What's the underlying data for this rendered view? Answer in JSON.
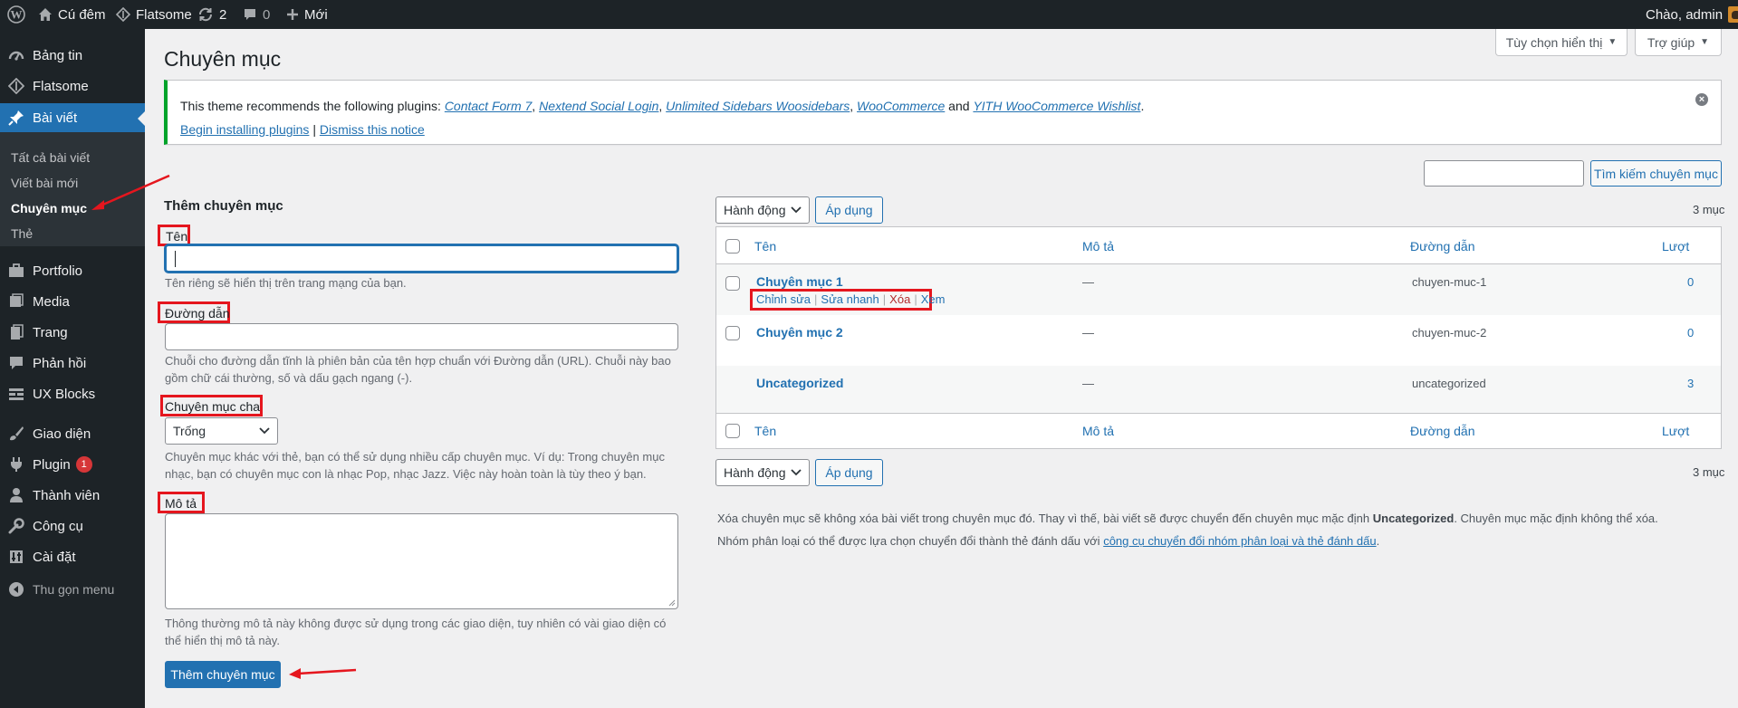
{
  "adminbar": {
    "site_name": "Cú đêm",
    "theme_name": "Flatsome",
    "updates_count": "2",
    "comments_count": "0",
    "new_label": "Mới",
    "greeting": "Chào, admin"
  },
  "sidebar": {
    "items": [
      {
        "label": "Bảng tin",
        "icon": "dashboard-icon"
      },
      {
        "label": "Flatsome",
        "icon": "flatsome-icon"
      },
      {
        "label": "Bài viết",
        "icon": "pin-icon"
      },
      {
        "label": "Portfolio",
        "icon": "portfolio-icon"
      },
      {
        "label": "Media",
        "icon": "media-icon"
      },
      {
        "label": "Trang",
        "icon": "page-icon"
      },
      {
        "label": "Phản hồi",
        "icon": "comment-icon"
      },
      {
        "label": "UX Blocks",
        "icon": "blocks-icon"
      },
      {
        "label": "Giao diện",
        "icon": "brush-icon"
      },
      {
        "label": "Plugin",
        "icon": "plugin-icon",
        "badge": "1"
      },
      {
        "label": "Thành viên",
        "icon": "user-icon"
      },
      {
        "label": "Công cụ",
        "icon": "wrench-icon"
      },
      {
        "label": "Cài đặt",
        "icon": "settings-icon"
      }
    ],
    "submenu": [
      "Tất cả bài viết",
      "Viết bài mới",
      "Chuyên mục",
      "Thẻ"
    ],
    "collapse_label": "Thu gọn menu"
  },
  "header": {
    "screen_options": "Tùy chọn hiển thị",
    "help": "Trợ giúp",
    "title": "Chuyên mục"
  },
  "notice": {
    "prefix": "This theme recommends the following plugins: ",
    "plugins": [
      "Contact Form 7",
      "Nextend Social Login",
      "Unlimited Sidebars Woosidebars",
      "WooCommerce",
      "YITH WooCommerce Wishlist"
    ],
    "sep": ", ",
    "and": " and ",
    "end": ".",
    "begin_link": "Begin installing plugins",
    "pipe": " | ",
    "dismiss_link": "Dismiss this notice"
  },
  "form": {
    "heading": "Thêm chuyên mục",
    "name_label": "Tên",
    "name_value": "",
    "name_desc": "Tên riêng sẽ hiển thị trên trang mạng của bạn.",
    "slug_label": "Đường dẫn",
    "slug_value": "",
    "slug_desc_1": "Chuỗi cho đường dẫn tĩnh là phiên bản của tên hợp chuẩn với Đường dẫn (URL). Chuỗi này bao",
    "slug_desc_2": "gồm chữ cái thường, số và dấu gạch ngang (-).",
    "parent_label": "Chuyên mục cha",
    "parent_value": "Trống",
    "parent_desc_1": "Chuyên mục khác với thẻ, bạn có thể sử dụng nhiều cấp chuyên mục. Ví dụ: Trong chuyên mục",
    "parent_desc_2": "nhạc, bạn có chuyên mục con là nhạc Pop, nhạc Jazz. Việc này hoàn toàn là tùy theo ý bạn.",
    "desc_label": "Mô tả",
    "desc_value": "",
    "desc_desc_1": "Thông thường mô tả này không được sử dụng trong các giao diện, tuy nhiên có vài giao diện có",
    "desc_desc_2": "thể hiển thị mô tả này.",
    "submit": "Thêm chuyên mục"
  },
  "list": {
    "search_value": "",
    "search_button": "Tìm kiếm chuyên mục",
    "bulk_action": "Hành động",
    "apply": "Áp dụng",
    "count_text": "3 mục",
    "columns": {
      "name": "Tên",
      "description": "Mô tả",
      "slug": "Đường dẫn",
      "count": "Lượt"
    },
    "rows": [
      {
        "name": "Chuyên mục 1",
        "description": "—",
        "slug": "chuyen-muc-1",
        "count": "0"
      },
      {
        "name": "Chuyên mục 2",
        "description": "—",
        "slug": "chuyen-muc-2",
        "count": "0"
      },
      {
        "name": "Uncategorized",
        "description": "—",
        "slug": "uncategorized",
        "count": "3"
      }
    ],
    "row_actions": {
      "edit": "Chỉnh sửa",
      "quick_edit": "Sửa nhanh",
      "delete": "Xóa",
      "view": "Xem",
      "sep": "|"
    },
    "note1_prefix": "Xóa chuyên mục sẽ không xóa bài viết trong chuyên mục đó. Thay vì thế, bài viết sẽ được chuyển đến chuyên mục mặc định ",
    "note1_bold": "Uncategorized",
    "note1_suffix": ". Chuyên mục mặc định không thể xóa.",
    "note2_prefix": "Nhóm phân loại có thể được lựa chọn chuyển đổi thành thẻ đánh dấu với ",
    "note2_link": "công cụ chuyển đổi nhóm phân loại và thẻ đánh dấu",
    "note2_suffix": "."
  },
  "colors": {
    "accent": "#2271b1",
    "sidebar": "#1d2327",
    "notice_border": "#00a32a",
    "annotation": "#e5161e"
  }
}
